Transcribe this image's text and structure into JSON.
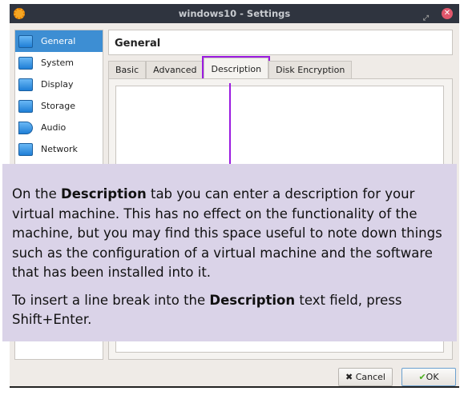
{
  "window": {
    "title": "windows10 - Settings"
  },
  "sidebar": {
    "items": [
      {
        "label": "General"
      },
      {
        "label": "System"
      },
      {
        "label": "Display"
      },
      {
        "label": "Storage"
      },
      {
        "label": "Audio"
      },
      {
        "label": "Network"
      }
    ]
  },
  "header": {
    "title": "General"
  },
  "tabs": [
    {
      "label": "Basic"
    },
    {
      "label": "Advanced"
    },
    {
      "label": "Description"
    },
    {
      "label": "Disk Encryption"
    }
  ],
  "buttons": {
    "cancel": "Cancel",
    "ok": "OK"
  },
  "callout": {
    "p1_pre": "On the ",
    "p1_bold": "Description",
    "p1_post": " tab you can enter a description for your virtual machine. This has no effect on the functionality of the machine, but you may find this space useful to note down things such as the configuration of a virtual machine and the software that has been installed into it.",
    "p2_pre": "To insert a line break into the ",
    "p2_bold": "Description",
    "p2_post": " text field, press Shift+Enter."
  },
  "colors": {
    "accent": "#3d8ed3",
    "highlight": "#9b1be0",
    "callout_bg": "#dad3e8"
  }
}
